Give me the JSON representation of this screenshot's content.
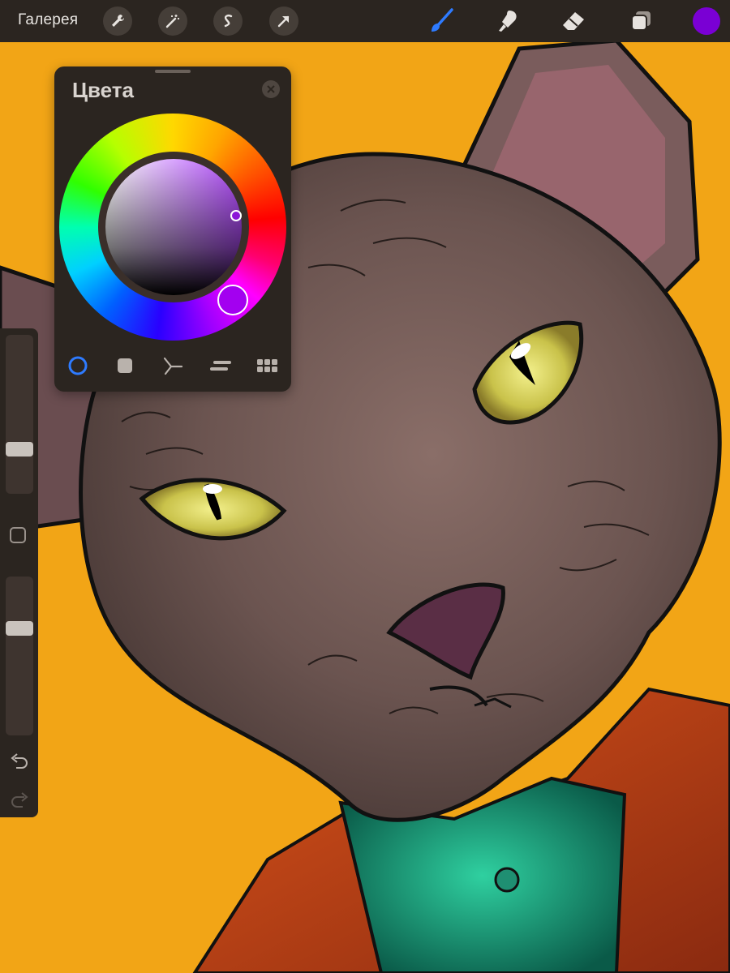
{
  "toolbar": {
    "gallery_label": "Галерея",
    "actions": [
      "wrench-icon",
      "magic-wand-icon",
      "selection-s-icon",
      "transform-arrow-icon"
    ],
    "tools": [
      "brush-icon",
      "smudge-icon",
      "eraser-icon",
      "layers-icon"
    ],
    "active_tool": "brush-icon",
    "current_color": "#7a00d4"
  },
  "colors_panel": {
    "title": "Цвета",
    "modes": [
      "disc",
      "classic",
      "harmony",
      "value",
      "palettes"
    ],
    "active_mode": "disc",
    "selected_hue_color": "#a300f0",
    "selected_color": "#8b16d8"
  },
  "sidebar": {
    "brush_size": 0.26,
    "opacity": 0.69
  },
  "colors": {
    "canvas_background": "#f2a516",
    "ui_dark": "#2b2520",
    "accent_blue": "#2e7bff"
  }
}
